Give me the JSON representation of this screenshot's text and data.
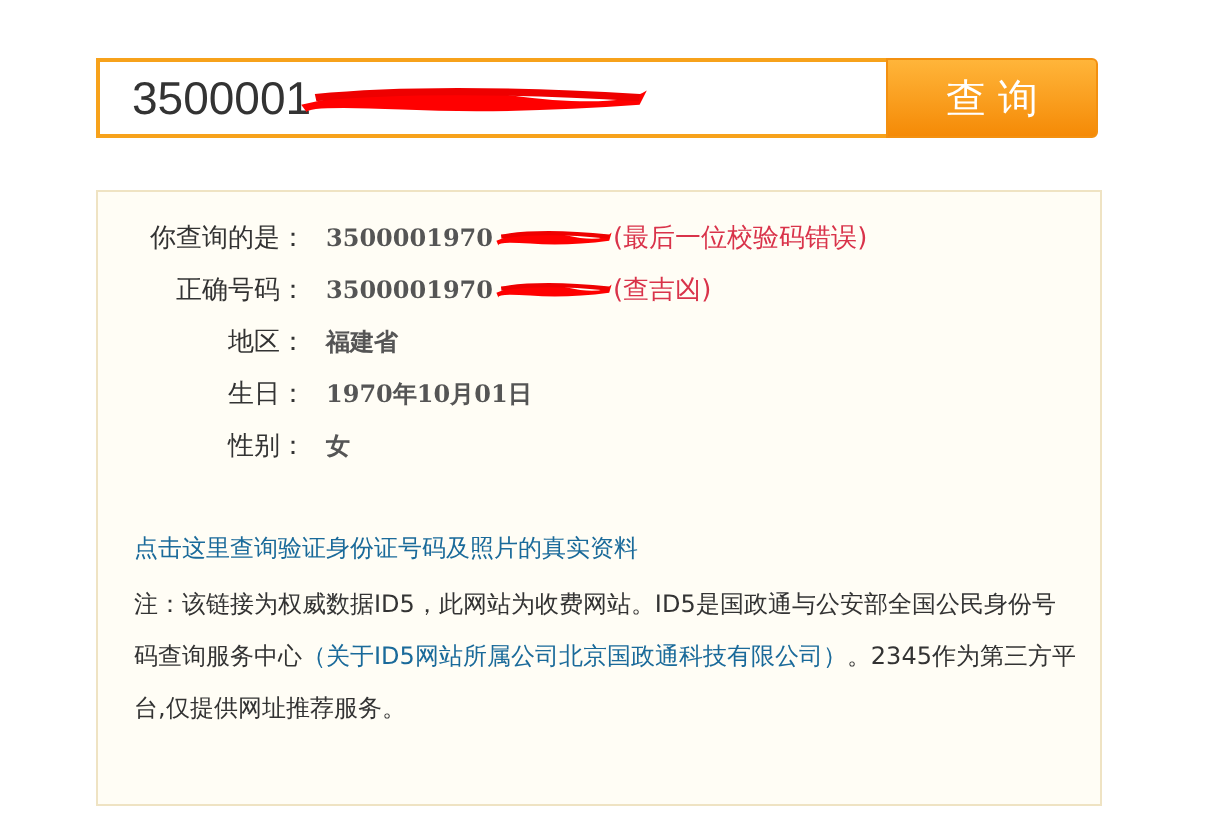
{
  "search": {
    "value": "3500001",
    "redacted": true,
    "button": "查 询"
  },
  "result": {
    "rows": [
      {
        "label": "你查询的是：",
        "value": "3500001970",
        "redacted": true,
        "note": "(最后一位校验码错误)"
      },
      {
        "label": "正确号码：",
        "value": "3500001970",
        "redacted": true,
        "note": "(查吉凶)"
      },
      {
        "label": "地区：",
        "value": "福建省",
        "redacted": false
      },
      {
        "label": "生日：",
        "value": "1970年10月01日",
        "redacted": false
      },
      {
        "label": "性别：",
        "value": "女",
        "redacted": false
      }
    ],
    "link": "点击这里查询验证身份证号码及照片的真实资料",
    "note": {
      "before": "注：该链接为权威数据ID5，此网站为收费网站。ID5是国政通与公安部全国公民身份号码查询服务中心",
      "link": "（关于ID5网站所属公司北京国政通科技有限公司）",
      "after": "。2345作为第三方平台,仅提供网址推荐服务。"
    }
  }
}
